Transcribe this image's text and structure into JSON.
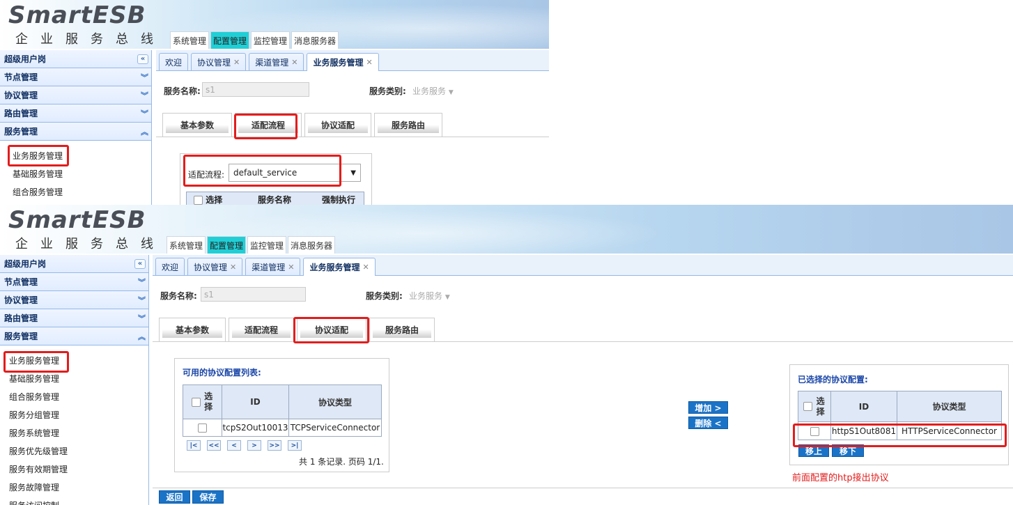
{
  "header": {
    "logo": "SmartESB",
    "slogan": "企业服务总线",
    "menu": [
      "系统管理",
      "配置管理",
      "监控管理",
      "消息服务器"
    ],
    "active_menu": "配置管理"
  },
  "sidebar": {
    "title": "超级用户岗",
    "groups": [
      "节点管理",
      "协议管理",
      "路由管理",
      "服务管理"
    ],
    "items_top": [
      "业务服务管理",
      "基础服务管理",
      "组合服务管理"
    ],
    "items_bottom": [
      "业务服务管理",
      "基础服务管理",
      "组合服务管理",
      "服务分组管理",
      "服务系统管理",
      "服务优先级管理",
      "服务有效期管理",
      "服务故障管理",
      "服务访问控制"
    ]
  },
  "page_tabs": [
    "欢迎",
    "协议管理",
    "渠道管理",
    "业务服务管理"
  ],
  "form": {
    "service_name_label": "服务名称:",
    "service_name_value": "s1",
    "service_type_label": "服务类别:",
    "service_type_value": "业务服务"
  },
  "sub_tabs": [
    "基本参数",
    "适配流程",
    "协议适配",
    "服务路由"
  ],
  "top_panel": {
    "flow_label": "适配流程:",
    "flow_value": "default_service",
    "table_headers": [
      "选择",
      "服务名称",
      "强制执行"
    ]
  },
  "available": {
    "title": "可用的协议配置列表:",
    "headers": [
      "选择",
      "ID",
      "协议类型"
    ],
    "rows": [
      {
        "id": "tcpS2Out10013",
        "type": "TCPServiceConnector"
      }
    ],
    "pager": [
      "|<",
      "<<",
      "<",
      ">",
      ">>",
      ">|"
    ],
    "summary": "共 1 条记录. 页码 1/1."
  },
  "buttons": {
    "add": "增加 >",
    "remove": "删除 <",
    "up": "移上",
    "down": "移下",
    "back": "返回",
    "save": "保存"
  },
  "selected": {
    "title": "已选择的协议配置:",
    "headers": [
      "选择",
      "ID",
      "协议类型"
    ],
    "rows": [
      {
        "id": "httpS1Out8081",
        "type": "HTTPServiceConnector"
      }
    ]
  },
  "annotation": "前面配置的htp接出协议"
}
